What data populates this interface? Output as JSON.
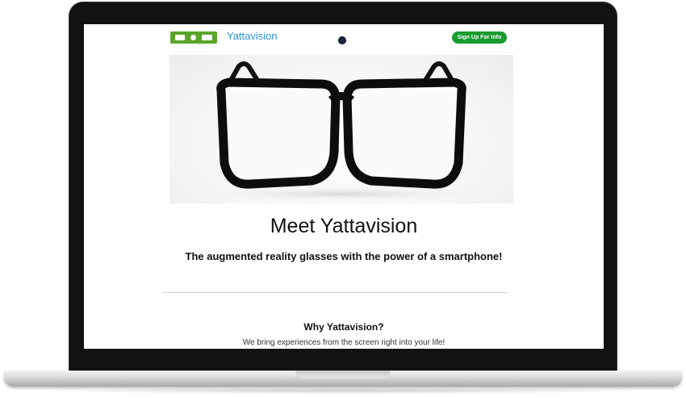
{
  "nav": {
    "brand": "Yattavision",
    "signup_label": "Sign Up For Info",
    "logo_color": "#5aa52a",
    "brand_color": "#2a93d5",
    "signup_color": "#189b2f"
  },
  "hero": {
    "image": "black-rimmed-eyeglasses"
  },
  "main": {
    "headline": "Meet Yattavision",
    "subheadline": "The augmented reality glasses with the power of a smartphone!"
  },
  "why": {
    "title": "Why Yattavision?",
    "text": "We bring experiences from the screen right into your life!"
  }
}
